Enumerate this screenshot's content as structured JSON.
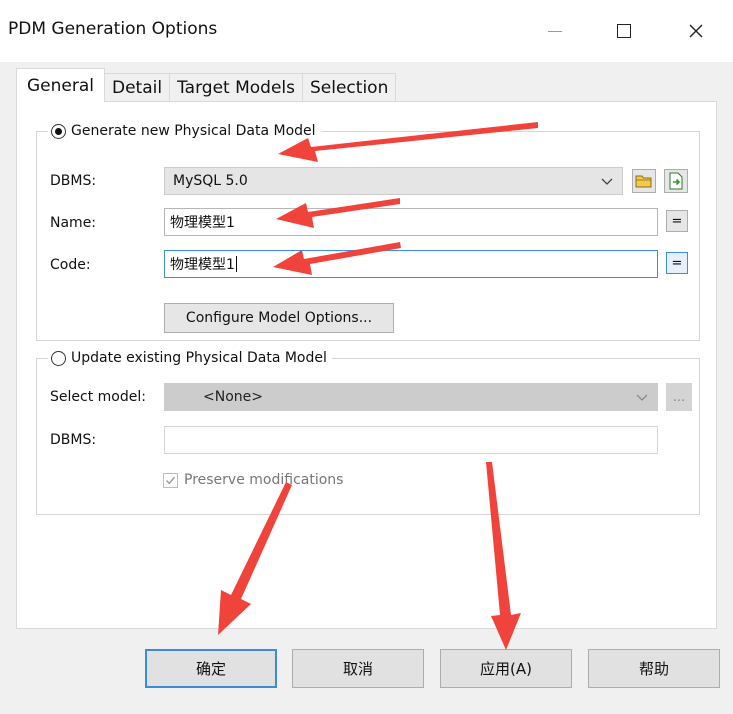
{
  "window": {
    "title": "PDM Generation Options"
  },
  "tabs": [
    {
      "label": "General",
      "active": true
    },
    {
      "label": "Detail",
      "active": false
    },
    {
      "label": "Target Models",
      "active": false
    },
    {
      "label": "Selection",
      "active": false
    }
  ],
  "generate_group": {
    "label": "Generate new Physical Data Model",
    "selected": true,
    "dbms_label": "DBMS:",
    "dbms_value": "MySQL 5.0",
    "name_label": "Name:",
    "name_value": "物理模型1",
    "code_label": "Code:",
    "code_value": "物理模型1",
    "equals_label": "=",
    "configure_button": "Configure Model Options..."
  },
  "update_group": {
    "label": "Update existing Physical Data Model",
    "selected": false,
    "select_model_label": "Select model:",
    "select_model_value": "<None>",
    "browse_label": "...",
    "dbms_label": "DBMS:",
    "dbms_value": "",
    "preserve_label": "Preserve modifications",
    "preserve_checked": true
  },
  "buttons": {
    "ok": "确定",
    "cancel": "取消",
    "apply": "应用(A)",
    "help": "帮助"
  },
  "colors": {
    "annotation_arrow": "#f0433c",
    "focus_border": "#3c8ad9"
  }
}
